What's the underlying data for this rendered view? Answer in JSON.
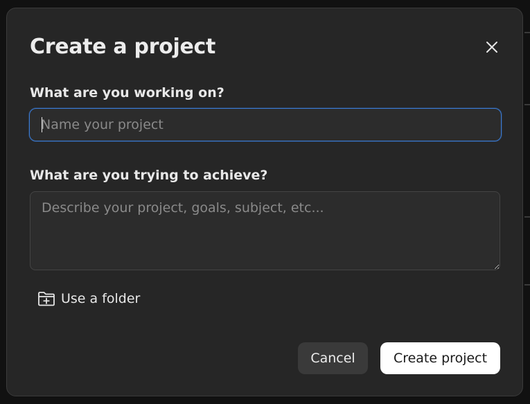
{
  "dialog": {
    "title": "Create a project",
    "close_icon": "close-icon"
  },
  "name_field": {
    "label": "What are you working on?",
    "placeholder": "Name your project",
    "value": ""
  },
  "goal_field": {
    "label": "What are you trying to achieve?",
    "placeholder": "Describe your project, goals, subject, etc...",
    "value": ""
  },
  "folder_action": {
    "label": "Use a folder",
    "icon": "folder-plus-icon"
  },
  "actions": {
    "cancel_label": "Cancel",
    "create_label": "Create project"
  },
  "colors": {
    "dialog_bg": "#262626",
    "focus_ring": "#3a7bd5",
    "primary_button_bg": "#ffffff",
    "secondary_button_bg": "#3a3a3a"
  }
}
